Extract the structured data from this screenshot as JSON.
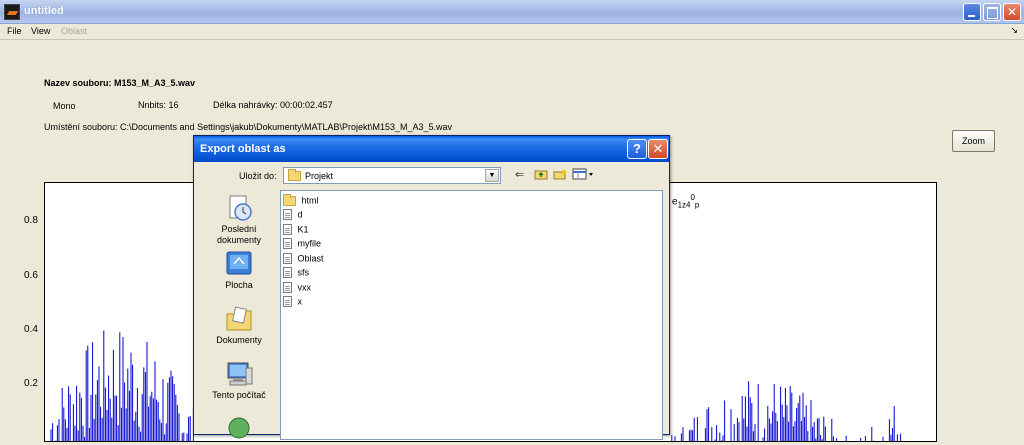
{
  "window": {
    "title": "untitled"
  },
  "menu": {
    "file": "File",
    "view": "View",
    "oblast": "Oblast",
    "arrow": "↘"
  },
  "info": {
    "filename": "Nazev souboru: M153_M_A3_5.wav",
    "channels": "Mono",
    "nbits": "Nnbits: 16",
    "duration": "Délka nahrávky: 00:00:02.457",
    "path": "Umístění souboru: C:\\Documents and Settings\\jakub\\Dokumenty\\MATLAB\\Projekt\\M153_M_A3_5.wav"
  },
  "zoom_label": "Zoom",
  "plot": {
    "yticks": [
      "0.8",
      "0.6",
      "0.4",
      "0.2"
    ],
    "annotation_base": "e",
    "annotation_sub": "1z4",
    "annotation_mid": "0",
    "annotation_end": "p"
  },
  "dialog": {
    "title": "Export oblast as",
    "save_in_label": "Uložit do:",
    "save_in_value": "Projekt",
    "places": [
      {
        "label": "Poslední dokumenty",
        "icon": "recent-documents-icon"
      },
      {
        "label": "Plocha",
        "icon": "desktop-icon"
      },
      {
        "label": "Dokumenty",
        "icon": "my-documents-icon"
      },
      {
        "label": "Tento počítač",
        "icon": "my-computer-icon"
      }
    ],
    "files": [
      {
        "name": "html",
        "type": "folder"
      },
      {
        "name": "d",
        "type": "file"
      },
      {
        "name": "K1",
        "type": "file"
      },
      {
        "name": "myfile",
        "type": "file"
      },
      {
        "name": "Oblast",
        "type": "file"
      },
      {
        "name": "sfs",
        "type": "file"
      },
      {
        "name": "vxx",
        "type": "file"
      },
      {
        "name": "x",
        "type": "file"
      }
    ]
  },
  "colors": {
    "signal": "#0000cc",
    "dialog_title": "#0058e6",
    "window_bg": "#ece9d8"
  }
}
